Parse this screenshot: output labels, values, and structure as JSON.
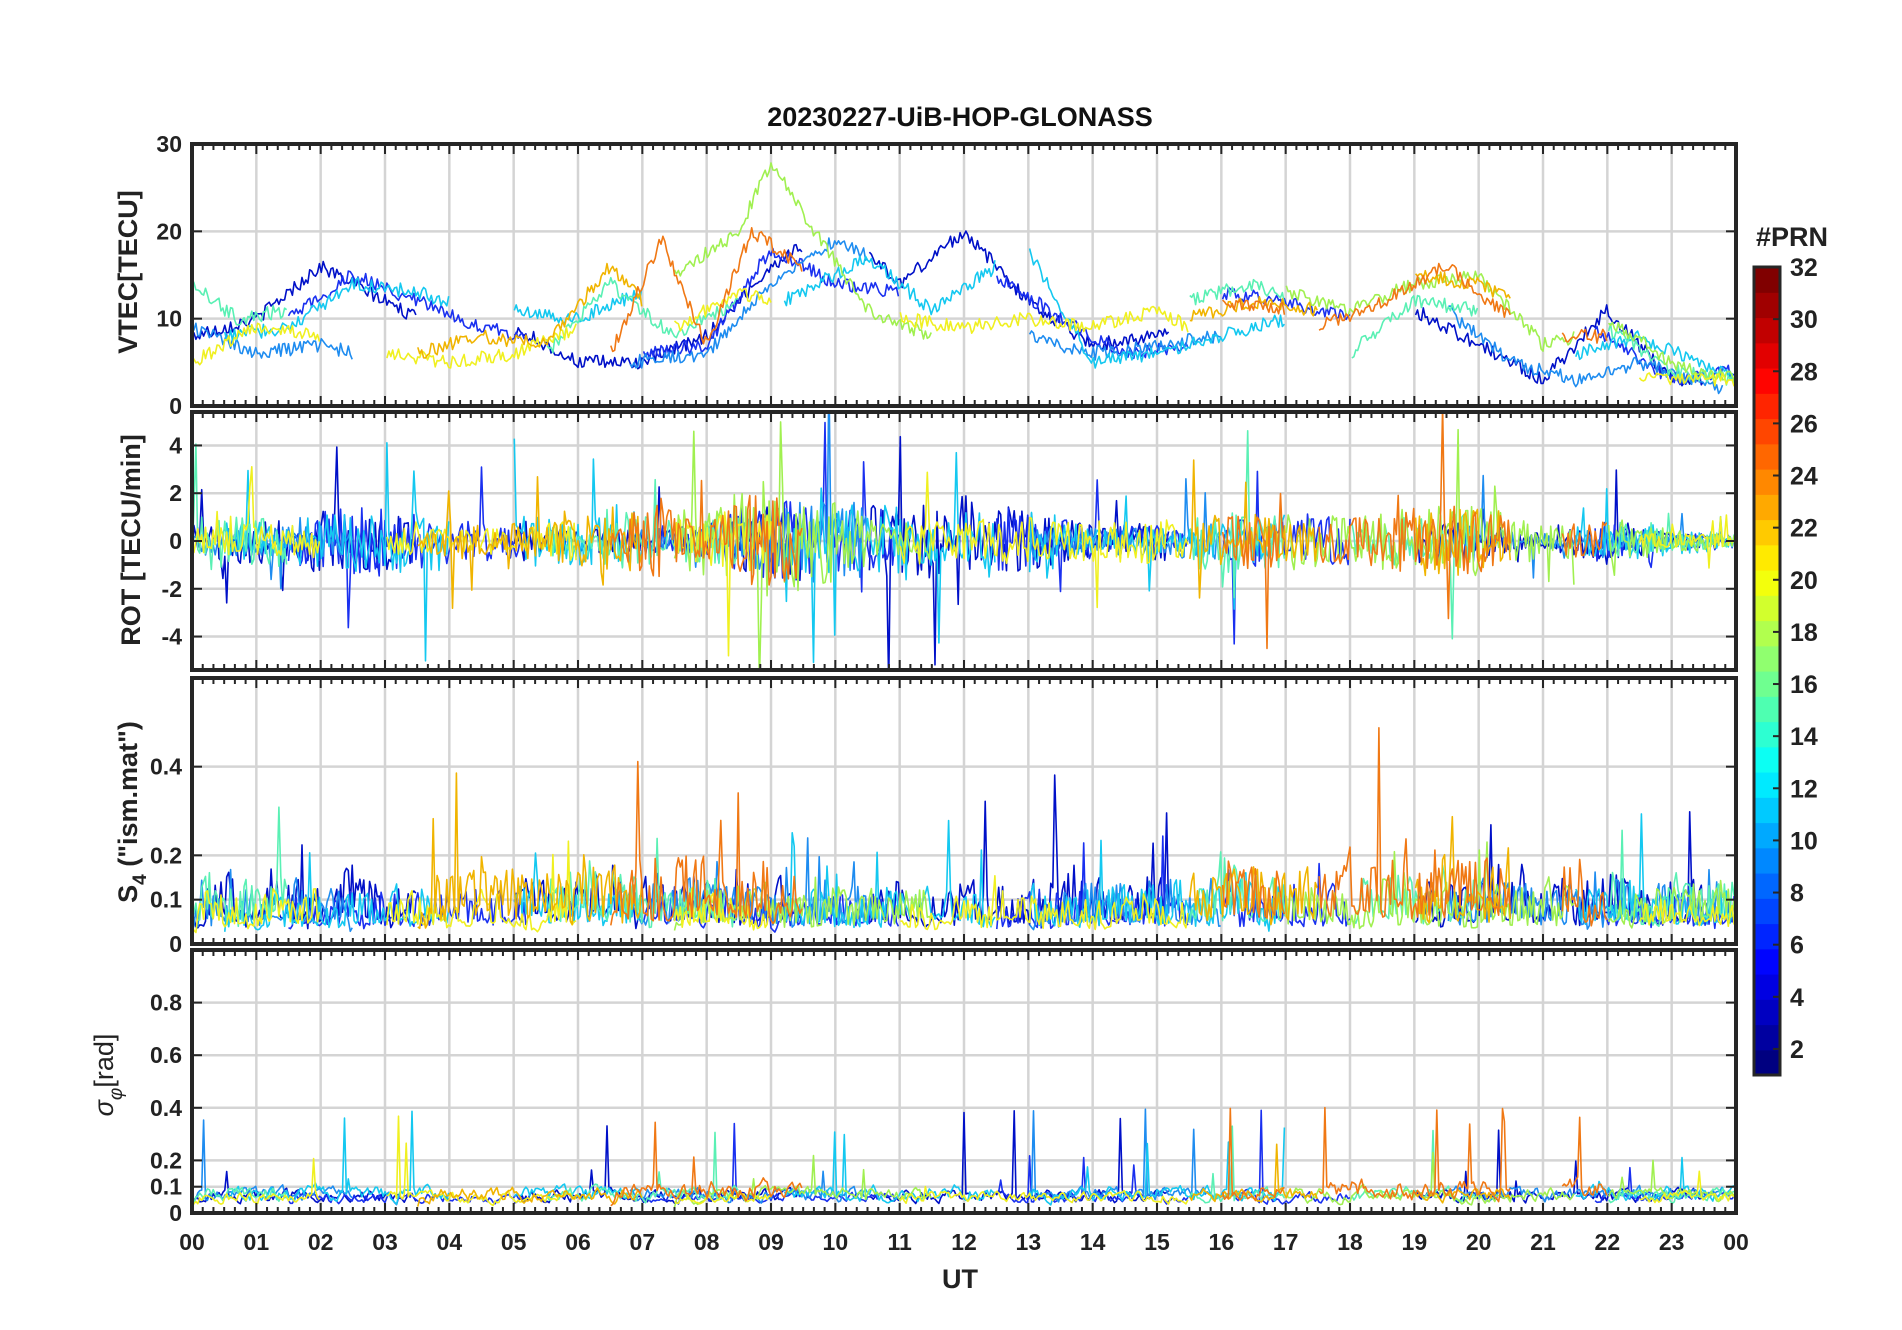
{
  "chart_data": {
    "type": "line",
    "title": "20230227-UiB-HOP-GLONASS",
    "xlabel": "UT",
    "x_tick_labels": [
      "00",
      "01",
      "02",
      "03",
      "04",
      "05",
      "06",
      "07",
      "08",
      "09",
      "10",
      "11",
      "12",
      "13",
      "14",
      "15",
      "16",
      "17",
      "18",
      "19",
      "20",
      "21",
      "22",
      "23",
      "00"
    ],
    "xlim_hours": [
      0,
      24
    ],
    "colorbar": {
      "label": "#PRN",
      "range": [
        1,
        32
      ],
      "tick_labels": [
        "2",
        "4",
        "6",
        "8",
        "10",
        "12",
        "14",
        "16",
        "18",
        "20",
        "22",
        "24",
        "26",
        "28",
        "30",
        "32"
      ],
      "colormap": "jet"
    },
    "panels": [
      {
        "ylabel": "VTEC[TECU]",
        "ylim": [
          0,
          30
        ],
        "y_tick_labels": [
          {
            "value": 0,
            "label": "0"
          },
          {
            "value": 10,
            "label": "10"
          },
          {
            "value": 20,
            "label": "20"
          },
          {
            "value": 30,
            "label": "30"
          }
        ]
      },
      {
        "ylabel": "ROT [TECU/min]",
        "ylim": [
          -5.4,
          5.4
        ],
        "y_tick_labels": [
          {
            "value": -4,
            "label": "-4"
          },
          {
            "value": -2,
            "label": "-2"
          },
          {
            "value": 0,
            "label": "0"
          },
          {
            "value": 2,
            "label": "2"
          },
          {
            "value": 4,
            "label": "4"
          }
        ]
      },
      {
        "ylabel": "S4 (\"ism.mat\")",
        "ylabel_main": "S",
        "ylabel_sub": "4",
        "ylabel_tail": " (\"ism.mat\")",
        "ylim": [
          0,
          0.6
        ],
        "y_tick_labels": [
          {
            "value": 0,
            "label": "0"
          },
          {
            "value": 0.1,
            "label": "0.1"
          },
          {
            "value": 0.2,
            "label": "0.2"
          },
          {
            "value": 0.4,
            "label": "0.4"
          }
        ]
      },
      {
        "ylabel": "σφ[rad]",
        "ylabel_main": "σ",
        "ylabel_sub": "φ",
        "ylabel_tail": "[rad]",
        "ylim": [
          0,
          1.0
        ],
        "y_tick_labels": [
          {
            "value": 0,
            "label": "0"
          },
          {
            "value": 0.1,
            "label": "0.1"
          },
          {
            "value": 0.2,
            "label": "0.2"
          },
          {
            "value": 0.4,
            "label": "0.4"
          },
          {
            "value": 0.6,
            "label": "0.6"
          },
          {
            "value": 0.8,
            "label": "0.8"
          }
        ]
      }
    ],
    "series": [
      {
        "prn": 2,
        "color": "#0010C8",
        "visible": [
          [
            0,
            3.5
          ],
          [
            5,
            9.5
          ],
          [
            10.5,
            15.2
          ],
          [
            19,
            23.5
          ]
        ],
        "vtec": [
          [
            0,
            8
          ],
          [
            1,
            10
          ],
          [
            2,
            16
          ],
          [
            3,
            12
          ],
          [
            4,
            8
          ],
          [
            5,
            9
          ],
          [
            6,
            5
          ],
          [
            7,
            5
          ],
          [
            8,
            8
          ],
          [
            9,
            16
          ],
          [
            10,
            21
          ],
          [
            11,
            14
          ],
          [
            12,
            20
          ],
          [
            13,
            12
          ],
          [
            14,
            7
          ],
          [
            15,
            8
          ],
          [
            19,
            11
          ],
          [
            20,
            7
          ],
          [
            21,
            3
          ],
          [
            22,
            11
          ],
          [
            23,
            3
          ]
        ],
        "s4_level": 0.18,
        "sigma_level": 0.09
      },
      {
        "prn": 5,
        "color": "#1A30F0",
        "visible": [
          [
            1.5,
            5.2
          ],
          [
            7,
            11
          ],
          [
            12.5,
            15.5
          ],
          [
            16,
            18
          ],
          [
            21.8,
            24
          ]
        ],
        "vtec": [
          [
            1.5,
            10
          ],
          [
            2.5,
            15
          ],
          [
            3.5,
            12
          ],
          [
            4.5,
            9
          ],
          [
            5.2,
            8
          ],
          [
            7,
            6
          ],
          [
            8,
            7
          ],
          [
            9,
            18
          ],
          [
            10,
            14
          ],
          [
            11,
            13
          ],
          [
            12.5,
            15
          ],
          [
            13.5,
            10
          ],
          [
            14.5,
            6
          ],
          [
            15.5,
            7
          ],
          [
            16,
            13
          ],
          [
            17,
            12
          ],
          [
            18,
            10
          ],
          [
            21.8,
            9
          ],
          [
            23,
            3
          ],
          [
            24,
            4
          ]
        ],
        "s4_level": 0.14,
        "sigma_level": 0.08
      },
      {
        "prn": 9,
        "color": "#1E8CF0",
        "visible": [
          [
            0,
            2.5
          ],
          [
            6.8,
            10.5
          ],
          [
            13,
            16
          ],
          [
            19.5,
            23.8
          ]
        ],
        "vtec": [
          [
            0,
            9
          ],
          [
            1,
            6
          ],
          [
            2,
            7
          ],
          [
            2.5,
            6
          ],
          [
            6.8,
            5
          ],
          [
            8,
            6
          ],
          [
            9,
            14
          ],
          [
            10,
            19
          ],
          [
            13,
            8
          ],
          [
            14,
            6
          ],
          [
            15,
            7
          ],
          [
            16,
            8
          ],
          [
            19.5,
            11
          ],
          [
            20.5,
            5
          ],
          [
            21.5,
            3
          ],
          [
            22.5,
            5
          ],
          [
            23.8,
            2
          ]
        ],
        "s4_level": 0.16,
        "sigma_level": 0.1
      },
      {
        "prn": 11,
        "color": "#14C8F0",
        "visible": [
          [
            0.5,
            4
          ],
          [
            5,
            7
          ],
          [
            9.2,
            12.5
          ],
          [
            13,
            17
          ],
          [
            21.5,
            24
          ]
        ],
        "vtec": [
          [
            0.5,
            8
          ],
          [
            1.5,
            9
          ],
          [
            2.5,
            14
          ],
          [
            3.5,
            13
          ],
          [
            4,
            12
          ],
          [
            5,
            11
          ],
          [
            6,
            10
          ],
          [
            7,
            13
          ],
          [
            9.2,
            12
          ],
          [
            10.5,
            17
          ],
          [
            11.5,
            11
          ],
          [
            12.5,
            16
          ],
          [
            13,
            18
          ],
          [
            14,
            5
          ],
          [
            15,
            6
          ],
          [
            16,
            8
          ],
          [
            17,
            10
          ],
          [
            21.5,
            6
          ],
          [
            22.5,
            8
          ],
          [
            24,
            3
          ]
        ],
        "s4_level": 0.15,
        "sigma_level": 0.11
      },
      {
        "prn": 15,
        "color": "#5AF0B4",
        "visible": [
          [
            0,
            1.5
          ],
          [
            5.5,
            8.5
          ],
          [
            15.5,
            17
          ],
          [
            18,
            20
          ],
          [
            22,
            24
          ]
        ],
        "vtec": [
          [
            0,
            14
          ],
          [
            0.7,
            10
          ],
          [
            1.5,
            11
          ],
          [
            5.5,
            6
          ],
          [
            6.5,
            14
          ],
          [
            7.5,
            8
          ],
          [
            8.5,
            12
          ],
          [
            15.5,
            12
          ],
          [
            16.5,
            14
          ],
          [
            17,
            12
          ],
          [
            18,
            6
          ],
          [
            19,
            12
          ],
          [
            20,
            11
          ],
          [
            22,
            9
          ],
          [
            23,
            4
          ],
          [
            24,
            3
          ]
        ],
        "s4_level": 0.2,
        "sigma_level": 0.1
      },
      {
        "prn": 17,
        "color": "#A0F050",
        "visible": [
          [
            7.5,
            11.5
          ],
          [
            17,
            21.5
          ],
          [
            22,
            24
          ]
        ],
        "vtec": [
          [
            7.5,
            15
          ],
          [
            8.5,
            20
          ],
          [
            9,
            28
          ],
          [
            9.5,
            22
          ],
          [
            10.5,
            11
          ],
          [
            11.5,
            8
          ],
          [
            17,
            13
          ],
          [
            18,
            11
          ],
          [
            19,
            14
          ],
          [
            20,
            15
          ],
          [
            21,
            7
          ],
          [
            21.5,
            8
          ],
          [
            22,
            10
          ],
          [
            23,
            5
          ],
          [
            24,
            3
          ]
        ],
        "s4_level": 0.16,
        "sigma_level": 0.1
      },
      {
        "prn": 20,
        "color": "#F0F020",
        "visible": [
          [
            0,
            2
          ],
          [
            3,
            6
          ],
          [
            7.5,
            9
          ],
          [
            11,
            15.5
          ],
          [
            22.5,
            24
          ]
        ],
        "vtec": [
          [
            0,
            5
          ],
          [
            1,
            9
          ],
          [
            2,
            8
          ],
          [
            3,
            6
          ],
          [
            4,
            5
          ],
          [
            5,
            6
          ],
          [
            6,
            9
          ],
          [
            7.5,
            9
          ],
          [
            8.5,
            13
          ],
          [
            9,
            12
          ],
          [
            11,
            10
          ],
          [
            12,
            9
          ],
          [
            13,
            10
          ],
          [
            14,
            9
          ],
          [
            15,
            11
          ],
          [
            15.5,
            9
          ],
          [
            22.5,
            3
          ],
          [
            24,
            3
          ]
        ],
        "s4_level": 0.13,
        "sigma_level": 0.08
      },
      {
        "prn": 22,
        "color": "#F0B400",
        "visible": [
          [
            3.5,
            7
          ],
          [
            15.5,
            17.5
          ],
          [
            19,
            20.5
          ]
        ],
        "vtec": [
          [
            3.5,
            6
          ],
          [
            4.5,
            8
          ],
          [
            5.5,
            7
          ],
          [
            6.5,
            16
          ],
          [
            7,
            12
          ],
          [
            15.5,
            10
          ],
          [
            16.5,
            12
          ],
          [
            17.5,
            11
          ],
          [
            19,
            15
          ],
          [
            20,
            14
          ],
          [
            20.5,
            12
          ]
        ],
        "s4_level": 0.22,
        "sigma_level": 0.1
      },
      {
        "prn": 24,
        "color": "#F07814",
        "visible": [
          [
            6.5,
            9.5
          ],
          [
            16,
            17
          ],
          [
            17.5,
            20.5
          ],
          [
            21.3,
            22
          ]
        ],
        "vtec": [
          [
            6.5,
            6
          ],
          [
            7.3,
            19
          ],
          [
            8,
            7
          ],
          [
            8.7,
            20
          ],
          [
            9.5,
            16
          ],
          [
            16,
            12
          ],
          [
            17,
            11
          ],
          [
            17.5,
            9
          ],
          [
            18.5,
            12
          ],
          [
            19.5,
            16
          ],
          [
            20.5,
            10
          ],
          [
            21.3,
            8
          ],
          [
            22,
            8
          ]
        ],
        "s4_level": 0.24,
        "sigma_level": 0.14
      }
    ]
  }
}
